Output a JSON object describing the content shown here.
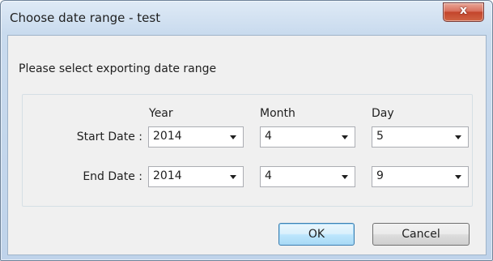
{
  "window": {
    "title": "Choose date range - test"
  },
  "dialog": {
    "prompt": "Please select exporting date range",
    "columns": {
      "year": "Year",
      "month": "Month",
      "day": "Day"
    },
    "start": {
      "label": "Start Date :",
      "year": "2014",
      "month": "4",
      "day": "5"
    },
    "end": {
      "label": "End Date :",
      "year": "2014",
      "month": "4",
      "day": "9"
    }
  },
  "buttons": {
    "close": "x",
    "ok": "OK",
    "cancel": "Cancel"
  }
}
